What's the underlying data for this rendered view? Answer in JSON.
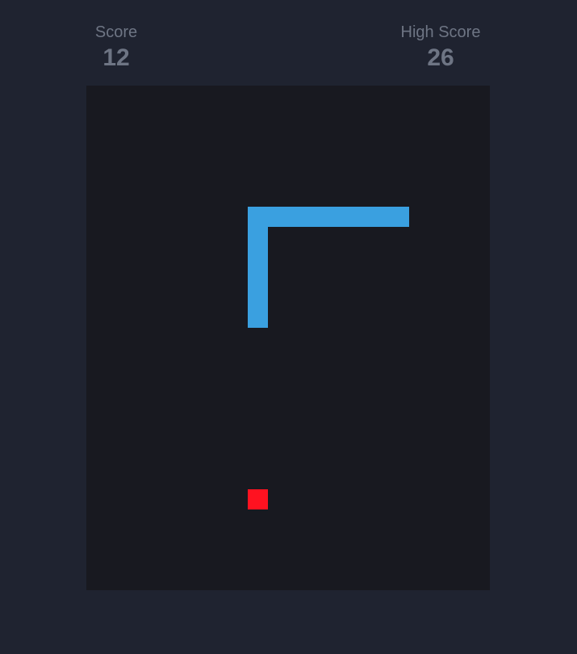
{
  "scoreboard": {
    "score_label": "Score",
    "score_value": "12",
    "high_score_label": "High Score",
    "high_score_value": "26"
  },
  "colors": {
    "background": "#1f2330",
    "board": "#181920",
    "snake": "#3aa0e0",
    "food": "#ff1220",
    "text": "#6e7584"
  }
}
